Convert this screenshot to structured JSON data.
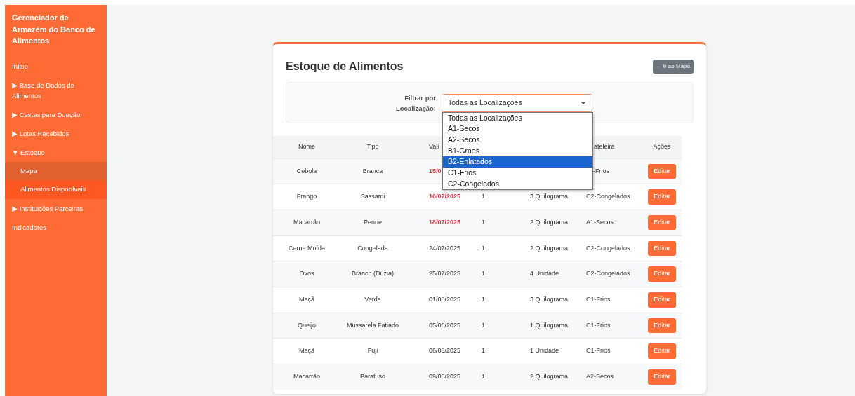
{
  "sidebar": {
    "title": "Gerenciador de Armazém do Banco de Alimentos",
    "items": [
      {
        "label": "Início",
        "selected": false,
        "hovered": false
      },
      {
        "label": "▶ Base de Dados de Alimentos",
        "selected": false,
        "hovered": false
      },
      {
        "label": "▶ Cestas para Doação",
        "selected": false,
        "hovered": false
      },
      {
        "label": "▶ Lotes Recebidos",
        "selected": false,
        "hovered": false
      },
      {
        "label": "▼ Estoque",
        "selected": false,
        "hovered": false,
        "children": [
          {
            "label": "Mapa",
            "selected": false,
            "hovered": true
          },
          {
            "label": "Alimentos Disponíveis",
            "selected": true,
            "hovered": false
          }
        ]
      },
      {
        "label": "▶ Instituições Parceiras",
        "selected": false,
        "hovered": false
      },
      {
        "label": "Indicadores",
        "selected": false,
        "hovered": false
      }
    ]
  },
  "page": {
    "title": "Estoque de Alimentos",
    "map_button": "← Ir ao Mapa"
  },
  "filter": {
    "label": "Filtrar por Localização:",
    "value": "Todas as Localizações",
    "expanded": true,
    "options": [
      {
        "label": "Todas as Localizações",
        "highlighted": false
      },
      {
        "label": "A1-Secos",
        "highlighted": false
      },
      {
        "label": "A2-Secos",
        "highlighted": false
      },
      {
        "label": "B1-Graos",
        "highlighted": false
      },
      {
        "label": "B2-Enlatados",
        "highlighted": true
      },
      {
        "label": "C1-Frios",
        "highlighted": false
      },
      {
        "label": "C2-Congelados",
        "highlighted": false
      }
    ]
  },
  "table": {
    "columns": [
      "Nome",
      "Tipo",
      "Vali",
      "",
      "",
      "ateleira",
      "Ações"
    ],
    "rows": [
      {
        "cells": [
          "Cebola",
          "Branca",
          "15/0",
          "",
          "",
          "-Frios"
        ],
        "urgent": true,
        "action": "Editar"
      },
      {
        "cells": [
          "Frango",
          "Sassami",
          "16/07/2025",
          "1",
          "3 Quilograma",
          "C2-Congelados"
        ],
        "urgent": true,
        "action": "Editar"
      },
      {
        "cells": [
          "Macarrão",
          "Penne",
          "18/07/2025",
          "1",
          "2 Quilograma",
          "A1-Secos"
        ],
        "urgent": true,
        "action": "Editar"
      },
      {
        "cells": [
          "Carne Moída",
          "Congelada",
          "24/07/2025",
          "1",
          "2 Quilograma",
          "C2-Congelados"
        ],
        "urgent": false,
        "action": "Editar"
      },
      {
        "cells": [
          "Ovos",
          "Branco (Dúzia)",
          "25/07/2025",
          "1",
          "4 Unidade",
          "C2-Congelados"
        ],
        "urgent": false,
        "action": "Editar"
      },
      {
        "cells": [
          "Maçã",
          "Verde",
          "01/08/2025",
          "1",
          "3 Quilograma",
          "C1-Frios"
        ],
        "urgent": false,
        "action": "Editar"
      },
      {
        "cells": [
          "Queijo",
          "Mussarela Fatiado",
          "05/08/2025",
          "1",
          "1 Quilograma",
          "C1-Frios"
        ],
        "urgent": false,
        "action": "Editar"
      },
      {
        "cells": [
          "Maçã",
          "Fuji",
          "06/08/2025",
          "1",
          "1 Unidade",
          "C1-Frios"
        ],
        "urgent": false,
        "action": "Editar"
      },
      {
        "cells": [
          "Macarrão",
          "Parafuso",
          "09/08/2025",
          "1",
          "2 Quilograma",
          "A2-Secos"
        ],
        "urgent": false,
        "action": "Editar"
      }
    ]
  }
}
